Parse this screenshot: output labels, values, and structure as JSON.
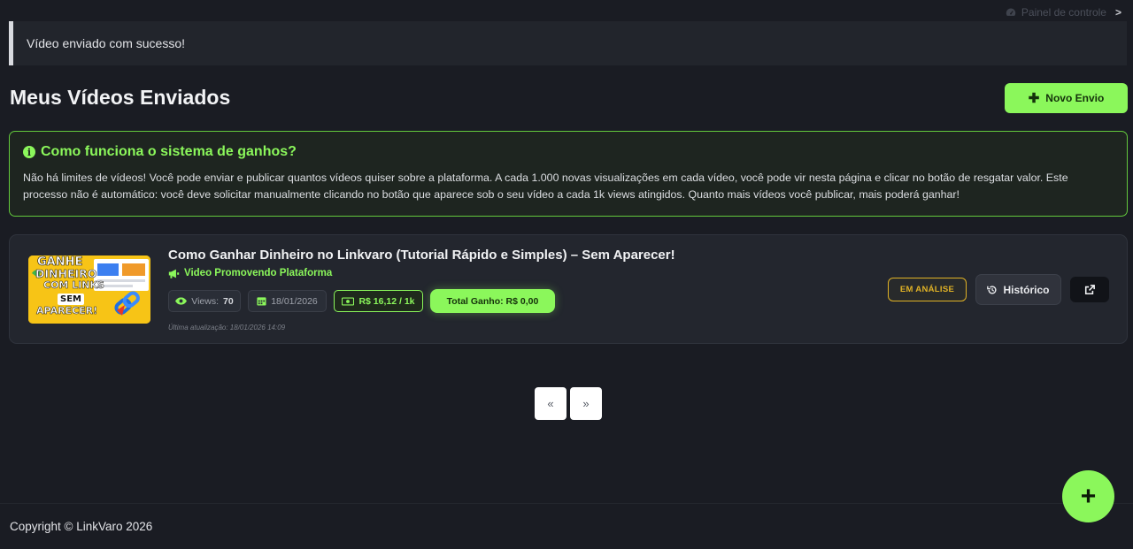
{
  "breadcrumb": {
    "label": "Painel de controle",
    "icon": "dashboard-icon",
    "separator": ">"
  },
  "alert": {
    "message": "Vídeo enviado com sucesso!"
  },
  "page": {
    "title": "Meus Vídeos Enviados"
  },
  "actions": {
    "new_upload_label": "Novo Envio"
  },
  "info": {
    "title": "Como funciona o sistema de ganhos?",
    "text": "Não há limites de vídeos! Você pode enviar e publicar quantos vídeos quiser sobre a plataforma. A cada 1.000 novas visualizações em cada vídeo, você pode vir nesta página e clicar no botão de resgatar valor. Este processo não é automático: você deve solicitar manualmente clicando no botão que aparece sob o seu vídeo a cada 1k views atingidos. Quanto mais vídeos você publicar, mais poderá ganhar!"
  },
  "video": {
    "title": "Como Ganhar Dinheiro no Linkvaro (Tutorial Rápido e Simples) – Sem Aparecer!",
    "tag": "Video Promovendo Plataforma",
    "views_label": "Views:",
    "views_value": "70",
    "date": "18/01/2026",
    "rate": "R$ 16,12 / 1k",
    "total": "Total Ganho: R$ 0,00",
    "updated": "Última atualização: 18/01/2026 14:09",
    "status": "EM ANÁLISE",
    "history_label": "Histórico",
    "thumbnail_text": [
      "GANHE",
      "DINHEIRO",
      "COM LINKS",
      "SEM",
      "APARECER!"
    ]
  },
  "pagination": {
    "prev": "«",
    "next": "»"
  },
  "footer": {
    "copyright": "Copyright © LinkVaro 2026"
  },
  "fab": {
    "label": "+"
  },
  "colors": {
    "accent": "#8bf75b",
    "background": "#1a1c23",
    "warning": "#e0b226"
  }
}
